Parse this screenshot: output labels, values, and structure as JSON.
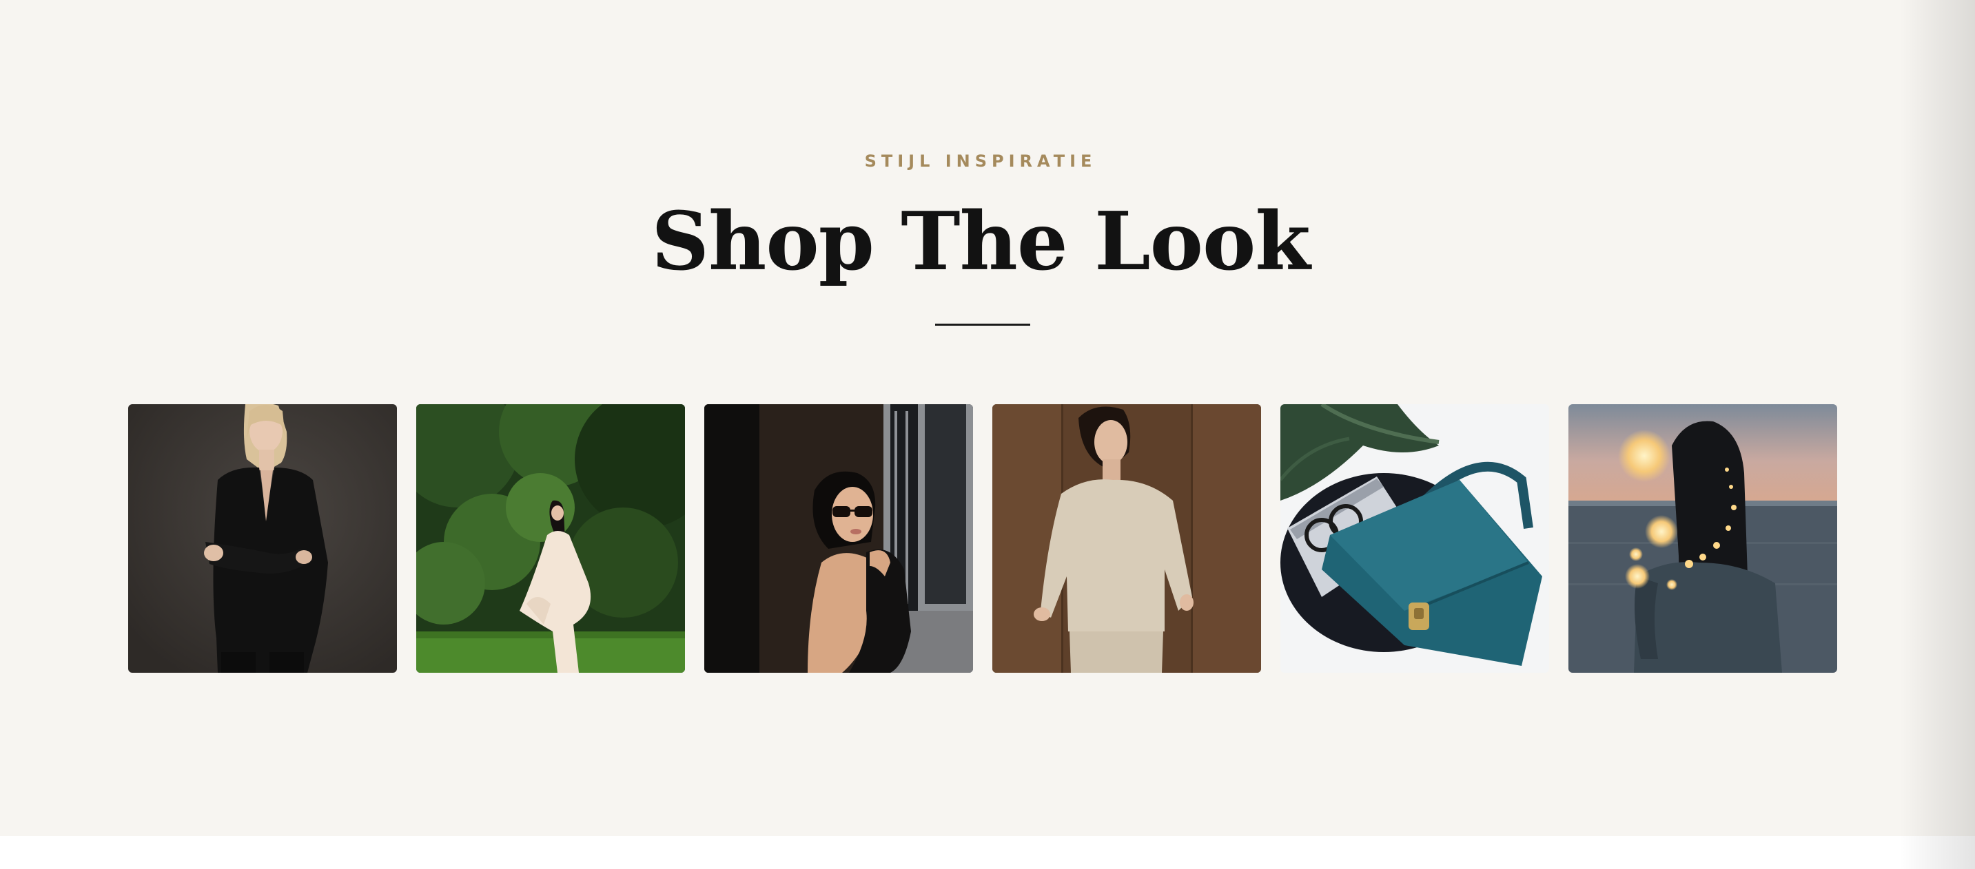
{
  "section": {
    "eyebrow": "STIJL INSPIRATIE",
    "title": "Shop The Look"
  },
  "gallery": {
    "items": [
      {
        "subject": "woman-black-blazer-photo",
        "bg": "#3c3835"
      },
      {
        "subject": "woman-white-dress-park-photo",
        "bg": "#22401c"
      },
      {
        "subject": "woman-sunglasses-city-photo",
        "bg": "#1b1917"
      },
      {
        "subject": "woman-beige-knit-photo",
        "bg": "#6e4f35"
      },
      {
        "subject": "teal-handbag-glasses-photo",
        "bg": "#f4f5f6"
      },
      {
        "subject": "woman-sea-fairy-lights-photo",
        "bg": "#4e5a66"
      }
    ]
  },
  "colors": {
    "accent": "#a58a5c",
    "background": "#f7f5f1",
    "heading": "#121212"
  }
}
